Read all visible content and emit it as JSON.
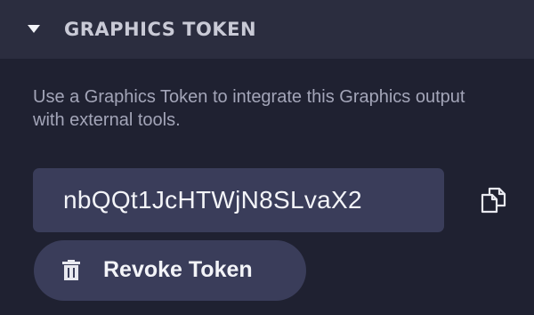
{
  "section": {
    "title": "GRAPHICS TOKEN",
    "expanded_icon": "caret-down-icon"
  },
  "description": "Use a Graphics Token to integrate this Graphics output with external tools.",
  "token": {
    "value": "nbQQt1JcHTWjN8SLvaX2",
    "copy_icon": "copy-icon"
  },
  "revoke": {
    "label": "Revoke Token",
    "icon": "trash-icon"
  },
  "colors": {
    "background": "#1f2131",
    "header": "#2b2d3f",
    "field": "#3a3d5a",
    "text_primary": "#f3f4f8",
    "text_secondary": "#a3a5b8"
  }
}
